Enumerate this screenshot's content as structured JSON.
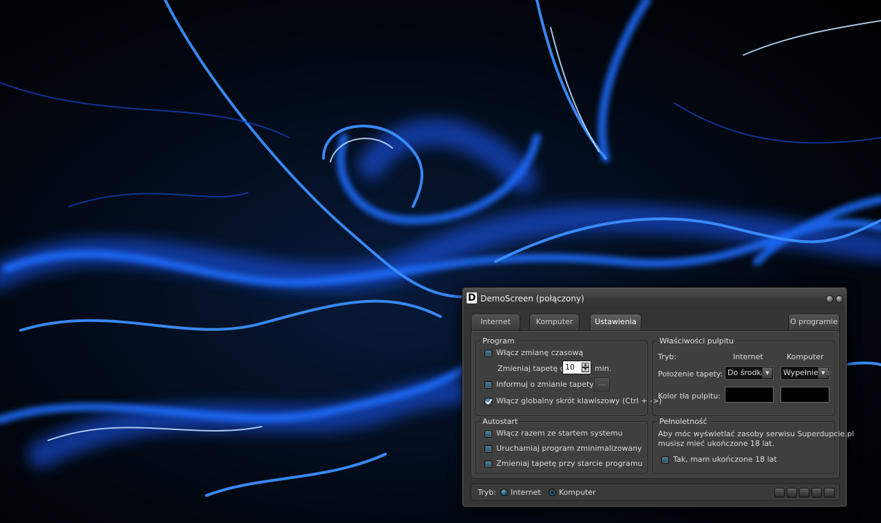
{
  "window": {
    "title": "DemoScreen (połączony)",
    "logo_letter": "D"
  },
  "tabs": [
    {
      "label": "Internet",
      "active": false
    },
    {
      "label": "Komputer",
      "active": false
    },
    {
      "label": "Ustawienia",
      "active": true
    },
    {
      "label": "O programie",
      "active": false
    }
  ],
  "program": {
    "title": "Program",
    "enable_timed_change": {
      "label": "Włącz zmianę czasową",
      "checked": false
    },
    "interval": {
      "label": "Zmieniaj tapetę co",
      "value": "10",
      "unit": "min."
    },
    "notify_change": {
      "label": "Informuj o zmianie tapety",
      "checked": false,
      "button_label": "..."
    },
    "global_shortcut": {
      "label": "Włącz globalny skrót klawiszowy (Ctrl + ->)",
      "checked": true
    }
  },
  "desktop": {
    "title": "Właściwości pulpitu",
    "mode_label": "Tryb:",
    "col_internet": "Internet",
    "col_computer": "Komputer",
    "position_label": "Położenie tapety:",
    "position_internet": "Do środka",
    "position_computer": "Wypełnienie",
    "bg_color_label": "Kolor tła pulpitu:",
    "color_internet": "#000000",
    "color_computer": "#000000"
  },
  "autostart": {
    "title": "Autostart",
    "with_system": {
      "label": "Włącz razem ze startem systemu",
      "checked": false
    },
    "minimized": {
      "label": "Uruchamiaj program zminimalizowany",
      "checked": false
    },
    "change_on_start": {
      "label": "Zmieniaj tapetę przy starcie programu",
      "checked": false
    }
  },
  "adult": {
    "title": "Pełnoletność",
    "text_line1": "Aby móc wyświetlać zasoby serwisu Superdupcie.pl",
    "text_line2": "musisz mieć ukończone 18 lat.",
    "confirm": {
      "label": "Tak, mam ukończone 18 lat",
      "checked": false
    }
  },
  "status": {
    "mode_label": "Tryb:",
    "options": [
      {
        "label": "Internet",
        "selected": false
      },
      {
        "label": "Komputer",
        "selected": true
      }
    ]
  },
  "colors": {
    "accent": "#2f7ea3",
    "window_bg": "#343434",
    "wallpaper_glow": "#1a66ff"
  }
}
